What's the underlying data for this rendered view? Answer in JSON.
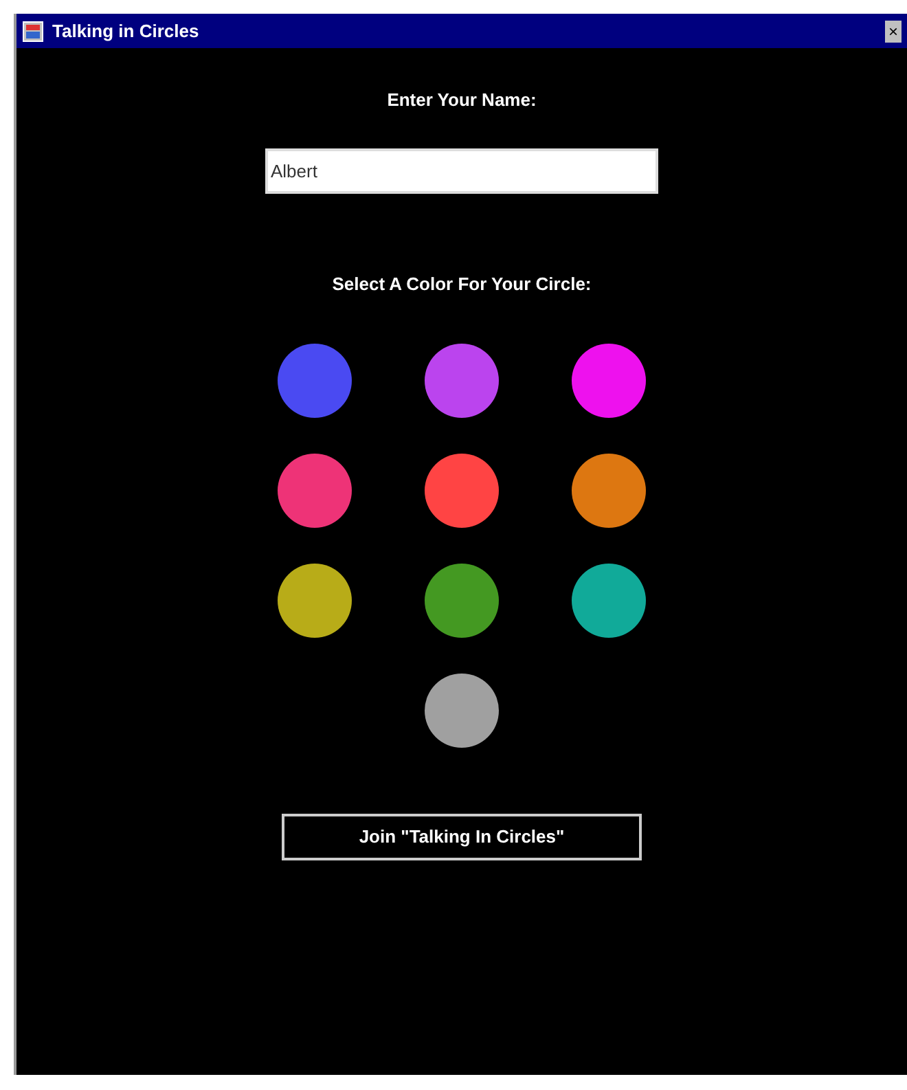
{
  "window": {
    "title": "Talking in Circles",
    "close": "×"
  },
  "name_prompt": "Enter Your Name:",
  "name_field": {
    "value": "Albert"
  },
  "color_prompt": "Select A Color For Your Circle:",
  "colors": [
    {
      "color": "#4a4af2"
    },
    {
      "color": "#bb44ee"
    },
    {
      "color": "#ee11ee"
    },
    {
      "color": "#ee3377"
    },
    {
      "color": "#ff4444"
    },
    {
      "color": "#dd7711"
    },
    {
      "color": "#b8ac18"
    },
    {
      "color": "#449922"
    },
    {
      "color": "#11aa99"
    },
    {
      "color": "#a0a0a0"
    }
  ],
  "join_button": "Join \"Talking In Circles\""
}
